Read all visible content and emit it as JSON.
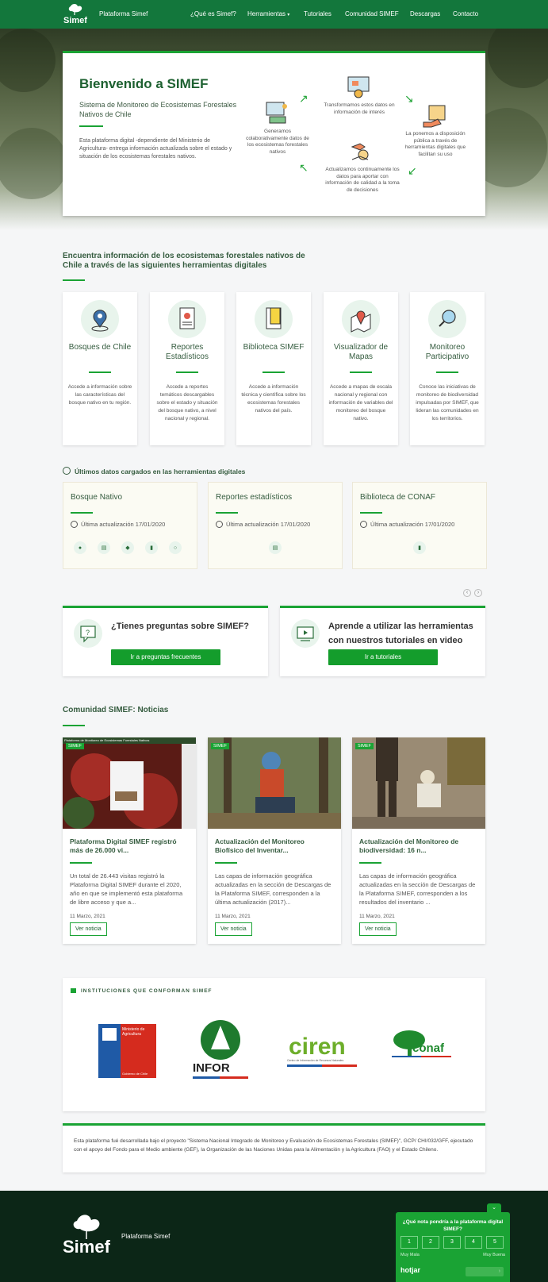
{
  "nav": {
    "brand": "Plataforma Simef",
    "items": [
      "¿Qué es Simef?",
      "Herramientas",
      "Tutoriales",
      "Comunidad SIMEF",
      "Descargas",
      "Contacto"
    ],
    "logo_text": "Simef"
  },
  "hero": {
    "title": "Bienvenido a SIMEF",
    "subtitle": "Sistema de Monitoreo de Ecosistemas Forestales Nativos de Chile",
    "description": "Esta plataforma digital -dependiente del Ministerio de Agricultura- entrega información actualizada sobre el estado y situación de los ecosistemas forestales nativos.",
    "cycle": [
      "Generamos colaborativamente datos de los ecosistemas forestales nativos",
      "Transformamos estos datos en información de interés",
      "La ponemos a disposición pública a través de herramientas digitales que facilitan su uso",
      "Actualizamos continuamente los datos para aportar con información de calidad a la toma de decisiones"
    ]
  },
  "tools": {
    "title": "Encuentra información de los ecosistemas forestales nativos de Chile a través de las siguientes herramientas digitales",
    "items": [
      {
        "name": "Bosques de Chile",
        "icon": "map-pin-info-icon",
        "desc": "Accede a información sobre las características del bosque nativo en tu región."
      },
      {
        "name": "Reportes Estadísticos",
        "icon": "report-chart-icon",
        "desc": "Accede a reportes temáticos descargables sobre el estado y situación del bosque nativo, a nivel nacional y regional."
      },
      {
        "name": "Biblioteca SIMEF",
        "icon": "book-icon",
        "desc": "Accede a información técnica y científica sobre los ecosistemas forestales nativos del país."
      },
      {
        "name": "Visualizador de Mapas",
        "icon": "map-marker-icon",
        "desc": "Accede a mapas de escala nacional y regional con información de variables del monitoreo del bosque nativo."
      },
      {
        "name": "Monitoreo Participativo",
        "icon": "magnifier-icon",
        "desc": "Conoce las iniciativas de monitoreo de biodiversidad impulsadas por SIMEF, que lideran las comunidades en los territorios."
      }
    ]
  },
  "updates": {
    "title": "Últimos datos cargados en las herramientas digitales",
    "items": [
      {
        "name": "Bosque Nativo",
        "date": "Última actualización 17/01/2020"
      },
      {
        "name": "Reportes estadísticos",
        "date": "Última actualización 17/01/2020"
      },
      {
        "name": "Biblioteca de CONAF",
        "date": "Última actualización 17/01/2020"
      }
    ],
    "prev": "‹",
    "next": "›"
  },
  "promos": [
    {
      "title": "¿Tienes preguntas sobre SIMEF?",
      "button": "Ir a preguntas frecuentes"
    },
    {
      "title": "Aprende a utilizar las herramientas con nuestros tutoriales en video",
      "button": "Ir a tutoriales"
    }
  ],
  "news": {
    "title": "Comunidad SIMEF: Noticias",
    "tag": "SIMEF",
    "items": [
      {
        "title": "Plataforma Digital SIMEF registró más de 26.000 vi...",
        "desc": "Un total de 26.443 visitas registró la Plataforma Digital SIMEF durante el 2020, año en que se implementó esta plataforma de libre acceso y que a...",
        "date": "11 Marzo, 2021",
        "button": "Ver noticia"
      },
      {
        "title": "Actualización del Monitoreo Biofísico del Inventar...",
        "desc": "Las capas de información geográfica actualizadas en la sección de Descargas de la Plataforma SIMEF, corresponden a la última actualización (2017)...",
        "date": "11 Marzo, 2021",
        "button": "Ver noticia"
      },
      {
        "title": "Actualización del Monitoreo de biodiversidad: 16 n...",
        "desc": "Las capas de información geográfica actualizadas en la sección de Descargas de la Plataforma SIMEF, corresponden a los resultados del inventario ...",
        "date": "11 Marzo, 2021",
        "button": "Ver noticia"
      }
    ],
    "screenshot_caption": "Plataforma de Monitoreo de Ecosistemas Forestales Nativos"
  },
  "institutions": {
    "title": "INSTITUCIONES QUE CONFORMAN SIMEF",
    "logos": [
      {
        "name": "Ministerio de Agricultura",
        "sub": "Gobierno de Chile"
      },
      {
        "name": "INFOR"
      },
      {
        "name": "ciren",
        "sub": "Centro de Información de Recursos Naturales"
      },
      {
        "name": "conaf"
      }
    ]
  },
  "footnote": "Esta plataforma fué desarrollada bajo el proyecto \"Sistema Nacional Integrado de Monitoreo y Evaluación de Ecosistemas Forestales (SIMEF)\", GCP/ CHI/032/GFF, ejecutado con el apoyo del Fondo para el Medio ambiente (GEF), la Organización de las Naciones Unidas para la Alimentación y la Agricultura (FAO) y el Estado Chileno.",
  "footer": {
    "brand": "Plataforma Simef",
    "logo_text": "Simef"
  },
  "hotjar": {
    "question": "¿Qué nota pondría a la plataforma digital SIMEF?",
    "scale": [
      "1",
      "2",
      "3",
      "4",
      "5"
    ],
    "low": "Muy Mala",
    "high": "Muy Buena",
    "brand": "hotjar"
  },
  "colors": {
    "primary": "#13773c",
    "accent": "#1aa334",
    "footer": "#0c2617"
  }
}
